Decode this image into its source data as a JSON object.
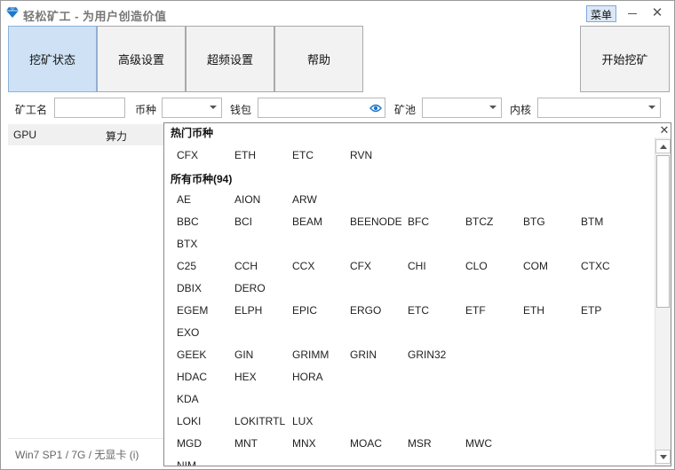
{
  "window": {
    "title": "轻松矿工 - 为用户创造价值",
    "menu_label": "菜单",
    "minimize_icon": "minimize-icon",
    "close_icon": "close-icon"
  },
  "tabs": [
    {
      "label": "挖矿状态",
      "active": true
    },
    {
      "label": "高级设置",
      "active": false
    },
    {
      "label": "超频设置",
      "active": false
    },
    {
      "label": "帮助",
      "active": false
    }
  ],
  "start_button": "开始挖矿",
  "config": {
    "miner_name_label": "矿工名",
    "miner_name_value": "",
    "coin_label": "币种",
    "coin_value": "",
    "wallet_label": "钱包",
    "wallet_value": "",
    "pool_label": "矿池",
    "pool_value": "",
    "kernel_label": "内核",
    "kernel_value": ""
  },
  "gpu_table": {
    "columns": [
      "GPU",
      "算力"
    ]
  },
  "status_text": "Win7 SP1 / 7G / 无显卡 (i)",
  "coin_popup": {
    "hot_title": "热门币种",
    "hot_coins": [
      "CFX",
      "ETH",
      "ETC",
      "RVN"
    ],
    "all_title": "所有币种(94)",
    "rows": [
      [
        "AE",
        "AION",
        "ARW"
      ],
      [
        "BBC",
        "BCI",
        "BEAM",
        "BEENODE",
        "BFC",
        "BTCZ",
        "BTG",
        "BTM"
      ],
      [
        "BTX"
      ],
      [
        "C25",
        "CCH",
        "CCX",
        "CFX",
        "CHI",
        "CLO",
        "COM",
        "CTXC"
      ],
      [
        "DBIX",
        "DERO"
      ],
      [
        "EGEM",
        "ELPH",
        "EPIC",
        "ERGO",
        "ETC",
        "ETF",
        "ETH",
        "ETP"
      ],
      [
        "EXO"
      ],
      [
        "GEEK",
        "GIN",
        "GRIMM",
        "GRIN",
        "GRIN32"
      ],
      [
        "HDAC",
        "HEX",
        "HORA"
      ],
      [
        "KDA"
      ],
      [
        "LOKI",
        "LOKITRTL",
        "LUX"
      ],
      [
        "MGD",
        "MNT",
        "MNX",
        "MOAC",
        "MSR",
        "MWC"
      ],
      [
        "NIM"
      ]
    ],
    "close_icon": "close-icon"
  },
  "colors": {
    "active_tab": "#cfe2f5",
    "accent_blue": "#1e77c8"
  }
}
